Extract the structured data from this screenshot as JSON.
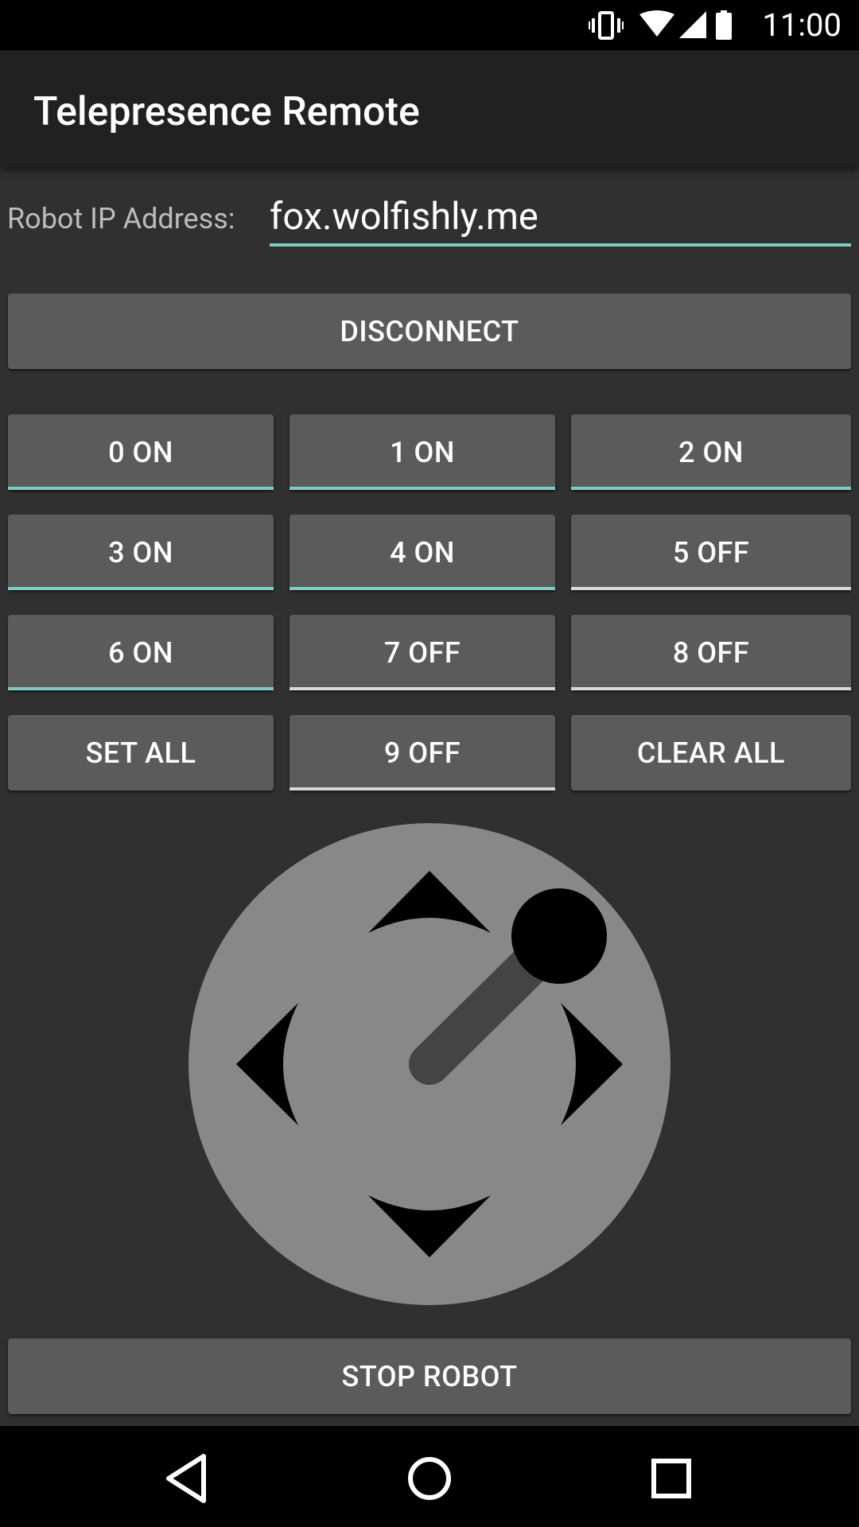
{
  "status_bar": {
    "time": "11:00",
    "icons": [
      "vibrate-icon",
      "wifi-icon",
      "cell-signal-icon",
      "battery-icon"
    ]
  },
  "app_bar": {
    "title": "Telepresence Remote"
  },
  "ip": {
    "label": "Robot IP Address:",
    "value": "fox.wolfishly.me"
  },
  "connect_button": {
    "label": "DISCONNECT"
  },
  "toggles": [
    {
      "label": "0 ON",
      "state": "on"
    },
    {
      "label": "1 ON",
      "state": "on"
    },
    {
      "label": "2 ON",
      "state": "on"
    },
    {
      "label": "3 ON",
      "state": "on"
    },
    {
      "label": "4 ON",
      "state": "on"
    },
    {
      "label": "5 OFF",
      "state": "off"
    },
    {
      "label": "6 ON",
      "state": "on"
    },
    {
      "label": "7 OFF",
      "state": "off"
    },
    {
      "label": "8 OFF",
      "state": "off"
    },
    {
      "label": "9 OFF",
      "state": "off"
    }
  ],
  "set_all": {
    "label": "SET ALL"
  },
  "clear_all": {
    "label": "CLEAR ALL"
  },
  "stop_button": {
    "label": "STOP ROBOT"
  },
  "colors": {
    "accent_on": "#80cbc4",
    "off_indicator": "#d8d8d8",
    "button_bg": "#5b5b5c",
    "joystick_bg": "#888888"
  },
  "nav_bar": {
    "icons": [
      "back-icon",
      "home-icon",
      "recents-icon"
    ]
  }
}
